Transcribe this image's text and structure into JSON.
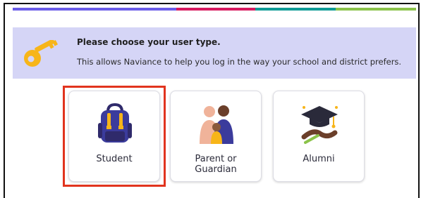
{
  "stripe_colors": [
    "#6a5ce8",
    "#d81b60",
    "#0f9b96",
    "#8bc34a"
  ],
  "banner": {
    "title": "Please choose your user type.",
    "description": "This allows Naviance to help you log in the way your school and district prefers.",
    "icon": "key-icon",
    "background": "#d5d5f6"
  },
  "user_types": [
    {
      "label": "Student",
      "icon": "backpack-icon",
      "selected": true
    },
    {
      "label": "Parent or\nGuardian",
      "icon": "parent-guardian-icon",
      "selected": false
    },
    {
      "label": "Alumni",
      "icon": "graduation-cap-icon",
      "selected": false
    }
  ],
  "highlight_color": "#e1341e"
}
